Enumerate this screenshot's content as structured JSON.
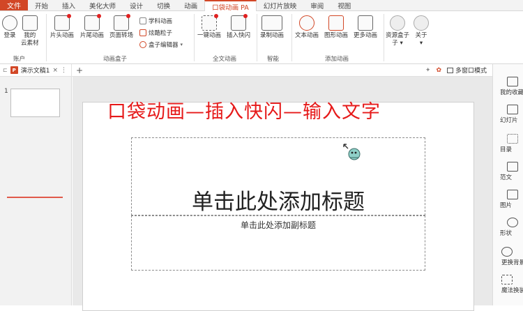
{
  "menu": {
    "file": "文件",
    "tabs": [
      "开始",
      "插入",
      "美化大师",
      "设计",
      "切换",
      "动画",
      "口袋动画 PA",
      "幻灯片放映",
      "审阅",
      "视图"
    ],
    "active_index": 6
  },
  "ribbon": {
    "account": {
      "login": "登录",
      "cloud": "我的\n云素材",
      "group": "账户"
    },
    "animbox": {
      "head": "片头动画",
      "tail": "片尾动画",
      "page": "页面转场",
      "subject": "学科动画",
      "particles": "炫酷粒子",
      "editor": "盒子编辑器",
      "group": "动画盒子"
    },
    "fulltext": {
      "one_key": "一键动画",
      "flash": "插入快闪",
      "group": "全文动画"
    },
    "smart": {
      "record": "录制动画",
      "group": "智能"
    },
    "add": {
      "text": "文本动画",
      "shape": "图形动画",
      "more": "更多动画",
      "group": "添加动画"
    },
    "resource": "资源盒子",
    "about": "关于"
  },
  "docbar": {
    "doc_tab": "演示文稿1",
    "close": "×",
    "more": "⋮",
    "plus": "+",
    "multi_window": "多窗口模式"
  },
  "thumbs": {
    "slide_number": "1"
  },
  "slide": {
    "overlay_title": "口袋动画—插入快闪—输入文字",
    "title_placeholder": "单击此处添加标题",
    "subtitle_placeholder": "单击此处添加副标题"
  },
  "sidebar": {
    "items": [
      "我的收藏",
      "幻灯片",
      "目录",
      "范文",
      "图片",
      "形状",
      "更换背景",
      "魔法换装"
    ]
  },
  "colors": {
    "accent": "#d24726",
    "overlay_red": "#e61919"
  }
}
